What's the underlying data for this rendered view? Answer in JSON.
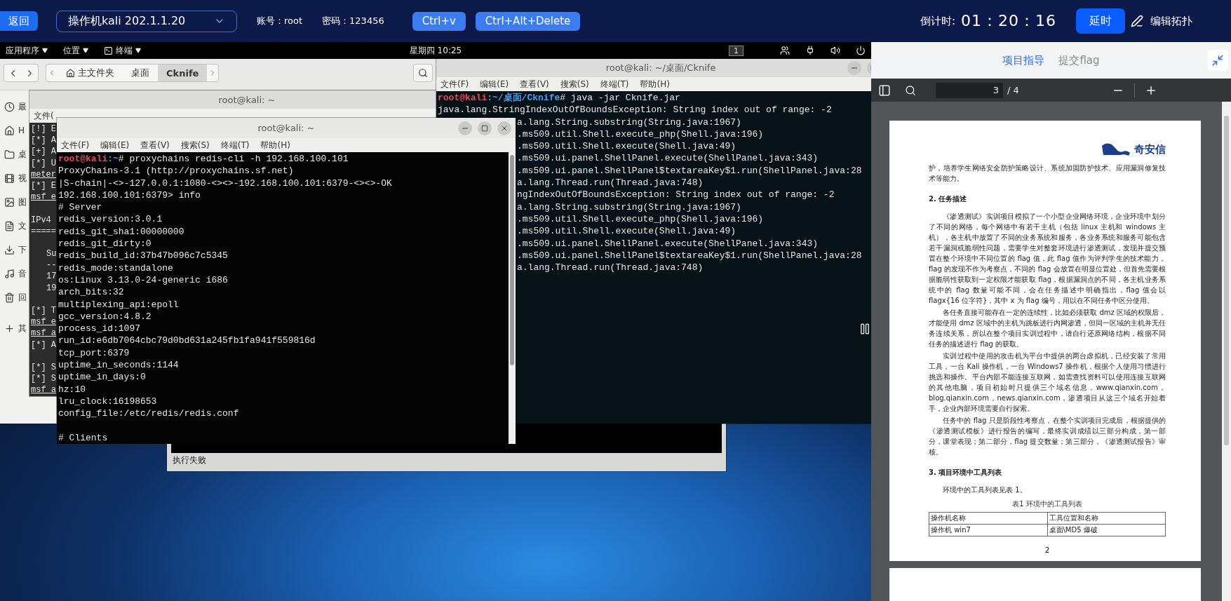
{
  "top_bar": {
    "back_button": "返回",
    "machine_select": "操作机kali 202.1.1.20",
    "account": "账号：root",
    "password": "密码：123456",
    "buttons": [
      "Ctrl+v",
      "Ctrl+Alt+Delete"
    ],
    "countdown_label": "倒计时:",
    "countdown": "01：20：16",
    "extend_button": "延时",
    "edit_topology": "编辑拓扑"
  },
  "desktop": {
    "panel": {
      "menus": [
        {
          "label": "应用程序",
          "kind": "text"
        },
        {
          "label": "位置",
          "kind": "text"
        },
        {
          "label": "终端",
          "kind": "terminal"
        }
      ],
      "clock": "星期四 10:25",
      "workspace": "1"
    },
    "file_manager": {
      "path": [
        {
          "label": "主文件夹",
          "kind": "home",
          "selected": false
        },
        {
          "label": "桌面",
          "kind": "text",
          "selected": false
        },
        {
          "label": "Cknife",
          "kind": "text",
          "selected": true
        }
      ],
      "sidebar": [
        {
          "label": "最",
          "kind": "recent"
        },
        {
          "label": "H",
          "kind": "home"
        },
        {
          "label": "桌",
          "kind": "folder"
        },
        {
          "label": "视",
          "kind": "video"
        },
        {
          "label": "图",
          "kind": "picture"
        },
        {
          "label": "文",
          "kind": "document"
        },
        {
          "label": "下",
          "kind": "download"
        },
        {
          "label": "音",
          "kind": "music"
        },
        {
          "label": "回",
          "kind": "trash"
        },
        {
          "label": "其",
          "kind": "other"
        }
      ]
    },
    "msf_terminal": {
      "title": "root@kali: ~",
      "menu": "文件(",
      "lines": [
        {
          "kind": "line",
          "text": "[!] E"
        },
        {
          "kind": "line",
          "text": "[*] A"
        },
        {
          "kind": "line",
          "text": "[+] A"
        },
        {
          "kind": "line",
          "text": "[*] U"
        },
        {
          "kind": "prompt",
          "text": "meter"
        },
        {
          "kind": "line",
          "text": "[*] E"
        },
        {
          "kind": "prompt",
          "text": "msf e"
        },
        {
          "kind": "gap"
        },
        {
          "kind": "line",
          "text": "IPv4"
        },
        {
          "kind": "line",
          "text": "====="
        },
        {
          "kind": "gap"
        },
        {
          "kind": "indented",
          "text": "Su"
        },
        {
          "kind": "indented",
          "text": "--"
        },
        {
          "kind": "indented",
          "text": "17"
        },
        {
          "kind": "indented",
          "text": "19"
        },
        {
          "kind": "gap"
        },
        {
          "kind": "line",
          "text": "[*] T"
        },
        {
          "kind": "prompt",
          "text": "msf e"
        },
        {
          "kind": "prompt",
          "text": "msf a"
        },
        {
          "kind": "line",
          "text": "[*] A"
        },
        {
          "kind": "gap"
        },
        {
          "kind": "line",
          "text": "[*] S"
        },
        {
          "kind": "line",
          "text": "[*] S"
        },
        {
          "kind": "prompt",
          "text": "msf a"
        }
      ]
    },
    "cknife_window": {
      "status": "执行失败"
    },
    "java_terminal": {
      "title": "root@kali: ~/桌面/Cknife",
      "menu": [
        "文件(F)",
        "编辑(E)",
        "查看(V)",
        "搜索(S)",
        "终端(T)",
        "帮助(H)"
      ],
      "prompt": {
        "user": "root@kali",
        "path": ":~/桌面/Cknife",
        "command": "# java -jar Cknife.jar"
      },
      "lines": [
        {
          "kind": "full",
          "text": "java.lang.StringIndexOutOfBoundsException: String index out of range: -2"
        },
        {
          "kind": "partial",
          "text": "a.lang.String.substring(String.java:1967)"
        },
        {
          "kind": "partial",
          "text": ".ms509.util.Shell.execute_php(Shell.java:196)"
        },
        {
          "kind": "partial",
          "text": ".ms509.util.Shell.execute(Shell.java:49)"
        },
        {
          "kind": "partial",
          "text": ".ms509.ui.panel.ShellPanel.execute(ShellPanel.java:343)"
        },
        {
          "kind": "partial",
          "text": ".ms509.ui.panel.ShellPanel$textareaKey$1.run(ShellPanel.java:28"
        },
        {
          "kind": "partial",
          "text": "a.lang.Thread.run(Thread.java:748)"
        },
        {
          "kind": "partial",
          "text": "ngIndexOutOfBoundsException: String index out of range: -2"
        },
        {
          "kind": "partial",
          "text": "a.lang.String.substring(String.java:1967)"
        },
        {
          "kind": "partial",
          "text": ".ms509.util.Shell.execute_php(Shell.java:196)"
        },
        {
          "kind": "partial",
          "text": ".ms509.util.Shell.execute(Shell.java:49)"
        },
        {
          "kind": "partial",
          "text": ".ms509.ui.panel.ShellPanel.execute(ShellPanel.java:343)"
        },
        {
          "kind": "partial",
          "text": ".ms509.ui.panel.ShellPanel$textareaKey$1.run(ShellPanel.java:28"
        },
        {
          "kind": "partial",
          "text": "a.lang.Thread.run(Thread.java:748)"
        }
      ]
    },
    "redis_terminal": {
      "title": "root@kali: ~",
      "menu": [
        "文件(F)",
        "编辑(E)",
        "查看(V)",
        "搜索(S)",
        "终端(T)",
        "帮助(H)"
      ],
      "prompt": {
        "user": "root@kali",
        "path": ":~",
        "command": "# proxychains redis-cli -h 192.168.100.101"
      },
      "lines": [
        "ProxyChains-3.1 (http://proxychains.sf.net)",
        "|S-chain|-<>-127.0.0.1:1080-<><>-192.168.100.101:6379-<><>-OK",
        "192.168.100.101:6379> info",
        "# Server",
        "redis_version:3.0.1",
        "redis_git_sha1:00000000",
        "redis_git_dirty:0",
        "redis_build_id:37b47b096c7c5345",
        "redis_mode:standalone",
        "os:Linux 3.13.0-24-generic i686",
        "arch_bits:32",
        "multiplexing_api:epoll",
        "gcc_version:4.8.2",
        "process_id:1097",
        "run_id:e6db7064cbc79d0bd631a245fb1fa941f559816d",
        "tcp_port:6379",
        "uptime_in_seconds:1144",
        "uptime_in_days:0",
        "hz:10",
        "lru_clock:16198653",
        "config_file:/etc/redis/redis.conf"
      ],
      "next_section": "# Clients"
    }
  },
  "side_panel": {
    "tabs": [
      {
        "label": "项目指导",
        "selected": true
      },
      {
        "label": "提交flag",
        "selected": false
      }
    ],
    "pdf": {
      "page": "3",
      "total": "/ 4",
      "logo": "奇安信",
      "blocks": [
        {
          "kind": "plain",
          "text": "护，培养学生网络安全防护策略设计、系统加固防护技术、应用漏洞修复技术等能力。"
        },
        {
          "kind": "heading",
          "text": "2. 任务描述"
        },
        {
          "kind": "para",
          "text": "《渗透测试》实训项目模拟了一个小型企业网络环境，企业环境中划分了不同的网络，每个网络中有若干主机（包括 linux 主机和 windows 主机），各主机中放置了不同的业务系统和服务，各业务系统和服务可能包含若干漏洞或脆弱性问题，需要学生对整套环境进行渗透测试，发现并提交预置在整个环境中不同位置的 flag 值，此 flag 值作为评判学生的技术能力，flag 的发现不作为考察点，不同的 flag 会放置在明显位置处，但首先需要根据脆弱性获取到一定权限才能获取 flag，根据漏洞点的不同，各主机业务系统中的 flag 数量可能不同，会在任务描述中明确指出，flag 值会以 flagx{16 位字符}，其中 x 为 flag 编号，用以在不同任务中区分使用。"
        },
        {
          "kind": "para",
          "text": "各任务直接可能存在一定的连续性，比如必须获取 dmz 区域的权限后，才能使用 dmz 区域中的主机为跳板进行内网渗透，但同一区域的主机并无任务连续关系，所以在整个项目实训过程中，请自行还原网络结构，根据不同任务的描述进行 flag 的获取。"
        },
        {
          "kind": "para",
          "text": "实训过程中使用的攻击机为平台中提供的两台虚拟机，已经安装了常用工具，一台 Kali 操作机，一台 Windows7 操作机，根据个人使用习惯进行挑选和操作。平台内部不能连接互联网，如需查找资料可以使用连接互联网的其他电脑，项目初始时只提供三个域名信息，www.qianxin.com，blog.qianxin.com，news.qianxin.com，渗透项目从这三个域名开始着手，企业内部环境需要自行探索。"
        },
        {
          "kind": "para",
          "text": "任务中的 flag 只是阶段性考察点，在整个实训项目完成后，根据提供的《渗透测试模板》进行报告的编写，最终实训成绩以三部分构成，第一部分，课堂表现；第二部分，flag 提交数量；第三部分，《渗透测试报告》审核。"
        },
        {
          "kind": "heading",
          "text": "3. 项目环境中工具列表"
        },
        {
          "kind": "para",
          "text": "环境中的工具列表见表 1。"
        }
      ],
      "table": {
        "caption": "表1 环境中的工具列表",
        "rows": [
          [
            "操作机名称",
            "工具位置和名称"
          ],
          [
            "操作机 win7",
            "桌面\\MD5 爆破"
          ]
        ]
      },
      "page_number": "2"
    }
  }
}
